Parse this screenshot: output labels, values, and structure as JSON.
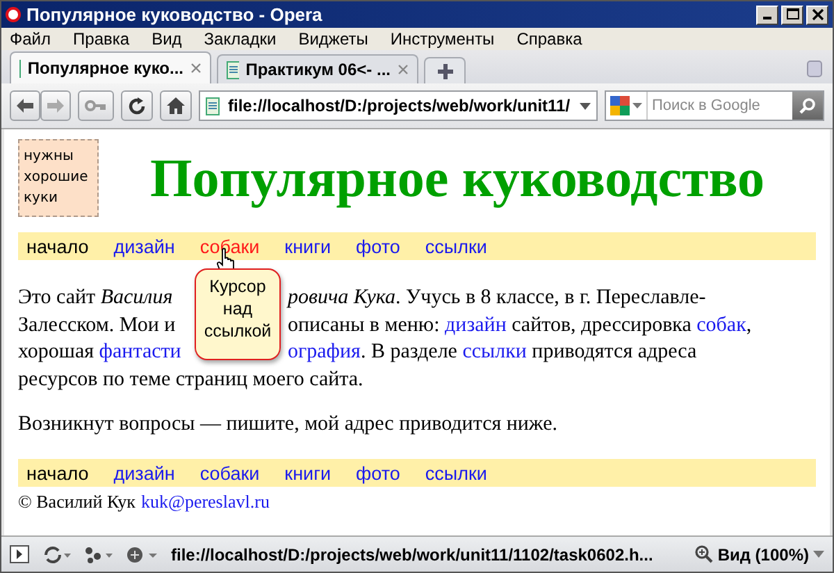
{
  "window": {
    "title": "Популярное куководство - Opera"
  },
  "menu": [
    "Файл",
    "Правка",
    "Вид",
    "Закладки",
    "Виджеты",
    "Инструменты",
    "Справка"
  ],
  "tabs": [
    {
      "label": "Популярное куко...",
      "selected": true
    },
    {
      "label": "Практикум 06<- ...",
      "selected": false
    }
  ],
  "address": {
    "value": "file://localhost/D:/projects/web/work/unit11/"
  },
  "search": {
    "placeholder": "Поиск в Google"
  },
  "page": {
    "logo_note": "нужны хорошие куки",
    "heading": "Популярное куководство",
    "nav_top": [
      {
        "label": "начало",
        "kind": "current"
      },
      {
        "label": "дизайн",
        "kind": "link"
      },
      {
        "label": "собаки",
        "kind": "hover"
      },
      {
        "label": "книги",
        "kind": "link"
      },
      {
        "label": "фото",
        "kind": "link"
      },
      {
        "label": "ссылки",
        "kind": "link"
      }
    ],
    "paragraph_lines": [
      [
        {
          "kind": "text",
          "text": "Это сайт "
        },
        {
          "kind": "italic",
          "text": "Василия"
        },
        {
          "kind": "gap"
        },
        {
          "kind": "italic",
          "text": "ровича Кука"
        },
        {
          "kind": "text",
          "text": ". Учусь в 8 классе, в г. Переславле-"
        }
      ],
      [
        {
          "kind": "text",
          "text": "Залесском. Мои и"
        },
        {
          "kind": "gap"
        },
        {
          "kind": "text",
          "text": "описаны в меню: "
        },
        {
          "kind": "link",
          "text": "дизайн"
        },
        {
          "kind": "text",
          "text": " сайтов, дрессировка "
        },
        {
          "kind": "link",
          "text": "собак"
        },
        {
          "kind": "text",
          "text": ","
        }
      ],
      [
        {
          "kind": "text",
          "text": "хорошая "
        },
        {
          "kind": "link",
          "text": "фантасти"
        },
        {
          "kind": "gap"
        },
        {
          "kind": "link",
          "text": "ография"
        },
        {
          "kind": "text",
          "text": ". В разделе "
        },
        {
          "kind": "link",
          "text": "ссылки"
        },
        {
          "kind": "text",
          "text": " приводятся адреса"
        }
      ],
      [
        {
          "kind": "text",
          "text": "ресурсов по теме страниц моего сайта."
        }
      ]
    ],
    "paragraph_2": "Возникнут вопросы — пишите, мой адрес приводится ниже.",
    "nav_bottom": [
      {
        "label": "начало",
        "kind": "current"
      },
      {
        "label": "дизайн",
        "kind": "link"
      },
      {
        "label": "собаки",
        "kind": "link"
      },
      {
        "label": "книги",
        "kind": "link"
      },
      {
        "label": "фото",
        "kind": "link"
      },
      {
        "label": "ссылки",
        "kind": "link"
      }
    ],
    "footer": {
      "text": "© Василий Кук",
      "email": "kuk@pereslavl.ru"
    },
    "tooltip": "Курсор над ссылкой"
  },
  "status_bar": {
    "url": "file://localhost/D:/projects/web/work/unit11/1102/task0602.h...",
    "zoom": "Вид (100%)"
  }
}
